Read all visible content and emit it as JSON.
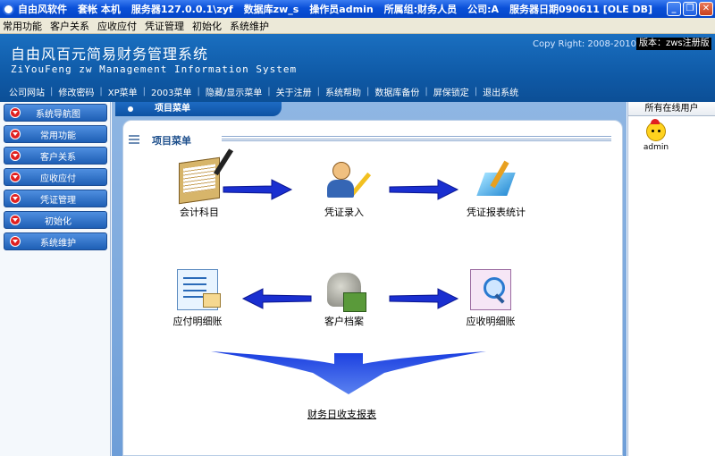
{
  "titlebar": {
    "segments": [
      "自由风软件",
      "套帐 本机",
      "服务器127.0.0.1\\zyf",
      "数据库zw_s",
      "操作员admin",
      "所属组:财务人员",
      "公司:A",
      "服务器日期090611 [OLE DB]"
    ],
    "minimize": "_",
    "maximize": "❐",
    "close": "✕"
  },
  "menubar": [
    "常用功能",
    "客户关系",
    "应收应付",
    "凭证管理",
    "初始化",
    "系统维护"
  ],
  "banner": {
    "title_cn": "自由风百元简易财务管理系统",
    "title_en": "ZiYouFeng zw Management Information System",
    "copyright": "Copy Right: 2008-2010",
    "version": "版本：zws注册版",
    "nav": [
      "公司网站",
      "修改密码",
      "XP菜单",
      "2003菜单",
      "隐藏/显示菜单",
      "关于注册",
      "系统帮助",
      "数据库备份",
      "屏保锁定",
      "退出系统"
    ]
  },
  "sidebar": [
    "系统导航图",
    "常用功能",
    "客户关系",
    "应收应付",
    "凭证管理",
    "初始化",
    "系统维护"
  ],
  "main": {
    "tab": "项目菜单",
    "panel_title": "项目菜单",
    "nodes": {
      "ledger": "会计科目",
      "entry": "凭证录入",
      "stats": "凭证报表统计",
      "payable": "应付明细账",
      "client": "客户档案",
      "receivable": "应收明细账"
    },
    "report": "财务日收支报表"
  },
  "online": {
    "title": "所有在线用户",
    "users": [
      "admin"
    ]
  }
}
